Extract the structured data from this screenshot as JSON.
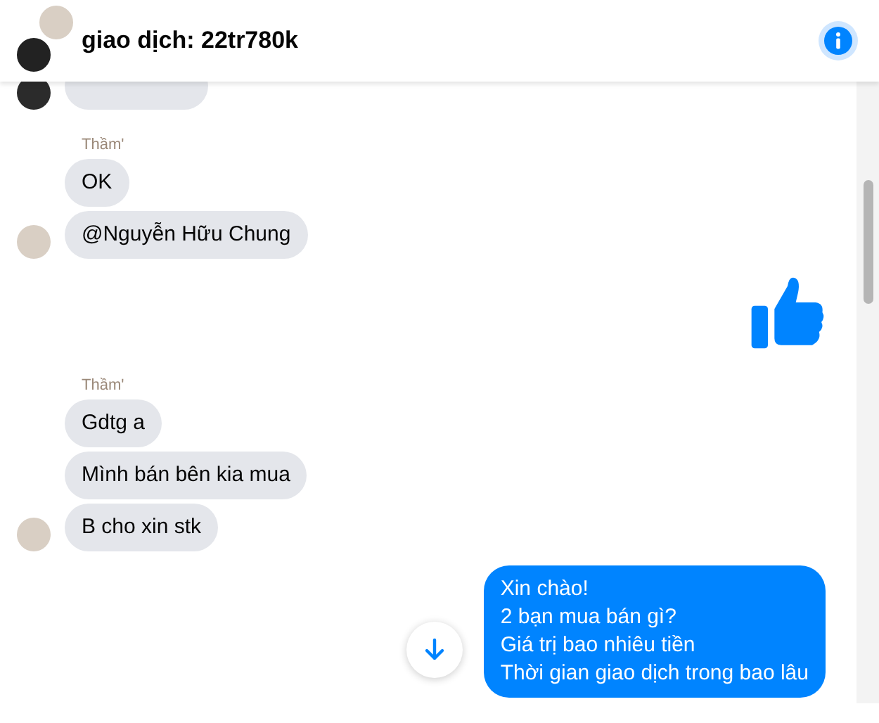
{
  "header": {
    "title": "giao dịch: 22tr780k"
  },
  "messages": [
    {
      "kind": "partial",
      "outgoing": false,
      "color": "#2b2b2b"
    },
    {
      "kind": "group",
      "outgoing": false,
      "sender": "Thầm'",
      "color": "#d9cfc4",
      "bubbles": [
        "OK",
        "@Nguyễn Hữu Chung"
      ]
    },
    {
      "kind": "like"
    },
    {
      "kind": "group",
      "outgoing": false,
      "sender": "Thầm'",
      "color": "#d9cfc4",
      "bubbles": [
        "Gdtg a",
        "Mình bán bên kia mua",
        "B cho xin stk"
      ]
    },
    {
      "kind": "group",
      "outgoing": true,
      "bubbles": [
        "Xin chào!\n2 bạn mua bán gì?\nGiá trị bao nhiêu tiền\nThời gian giao dịch trong bao lâu"
      ]
    }
  ]
}
